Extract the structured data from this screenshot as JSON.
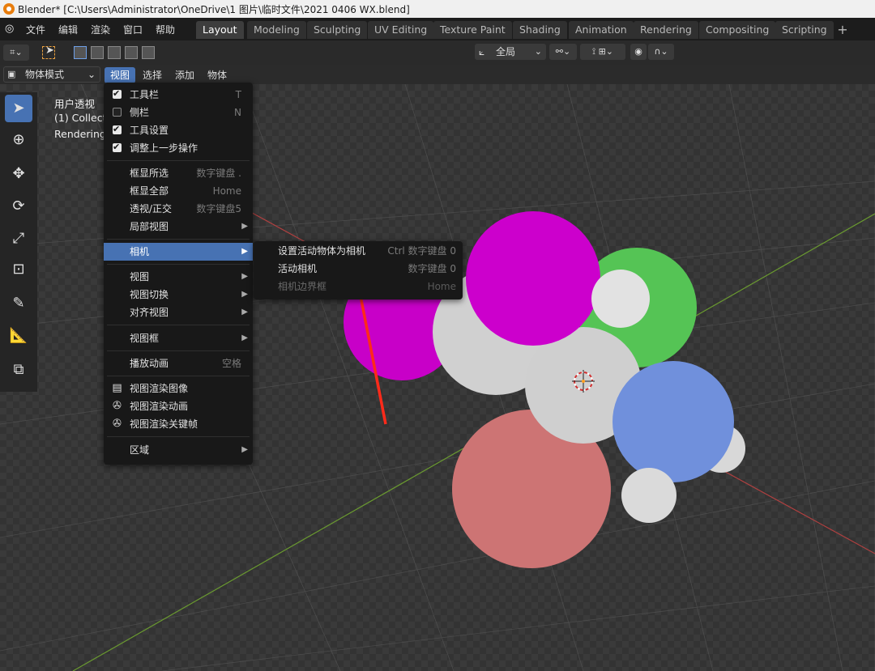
{
  "window": {
    "title": "Blender* [C:\\Users\\Administrator\\OneDrive\\1 图片\\临时文件\\2021 0406 WX.blend]"
  },
  "top_menu": [
    "文件",
    "编辑",
    "渲染",
    "窗口",
    "帮助"
  ],
  "workspace_tabs": [
    "Layout",
    "Modeling",
    "Sculpting",
    "UV Editing",
    "Texture Paint",
    "Shading",
    "Animation",
    "Rendering",
    "Compositing",
    "Scripting"
  ],
  "workspace_add": "+",
  "header": {
    "orientation_label": "全局"
  },
  "viewport_header": {
    "mode": "物体模式",
    "menus": [
      "视图",
      "选择",
      "添加",
      "物体"
    ]
  },
  "viewport_overlay": {
    "line1": "用户透视",
    "line2": "(1) Collecti",
    "line3": "Rendering"
  },
  "view_menu": {
    "items": [
      {
        "label": "工具栏",
        "shortcut": "T",
        "checked": true
      },
      {
        "label": "侧栏",
        "shortcut": "N",
        "checked": false
      },
      {
        "label": "工具设置",
        "shortcut": "",
        "checked": true
      },
      {
        "label": "调整上一步操作",
        "shortcut": "",
        "checked": true
      },
      {
        "label": "框显所选",
        "shortcut": "数字键盘 ."
      },
      {
        "label": "框显全部",
        "shortcut": "Home"
      },
      {
        "label": "透视/正交",
        "shortcut": "数字键盘5"
      },
      {
        "label": "局部视图",
        "shortcut": ""
      },
      {
        "label": "相机",
        "shortcut": ""
      },
      {
        "label": "视图",
        "shortcut": ""
      },
      {
        "label": "视图切换",
        "shortcut": ""
      },
      {
        "label": "对齐视图",
        "shortcut": ""
      },
      {
        "label": "视图框",
        "shortcut": ""
      },
      {
        "label": "播放动画",
        "shortcut": "空格"
      },
      {
        "label": "视图渲染图像",
        "shortcut": ""
      },
      {
        "label": "视图渲染动画",
        "shortcut": ""
      },
      {
        "label": "视图渲染关键帧",
        "shortcut": ""
      },
      {
        "label": "区域",
        "shortcut": ""
      }
    ]
  },
  "camera_submenu": {
    "items": [
      {
        "label": "设置活动物体为相机",
        "shortcut": "Ctrl 数字键盘 0"
      },
      {
        "label": "活动相机",
        "shortcut": "数字键盘 0"
      },
      {
        "label": "相机边界框",
        "shortcut": "Home"
      }
    ]
  },
  "colors": {
    "accent": "#4772b3",
    "magenta": "#d000d0",
    "green": "#58c858",
    "blue": "#6a8fe0",
    "pink": "#d07878",
    "white_sphere": "#d4d4d4"
  }
}
